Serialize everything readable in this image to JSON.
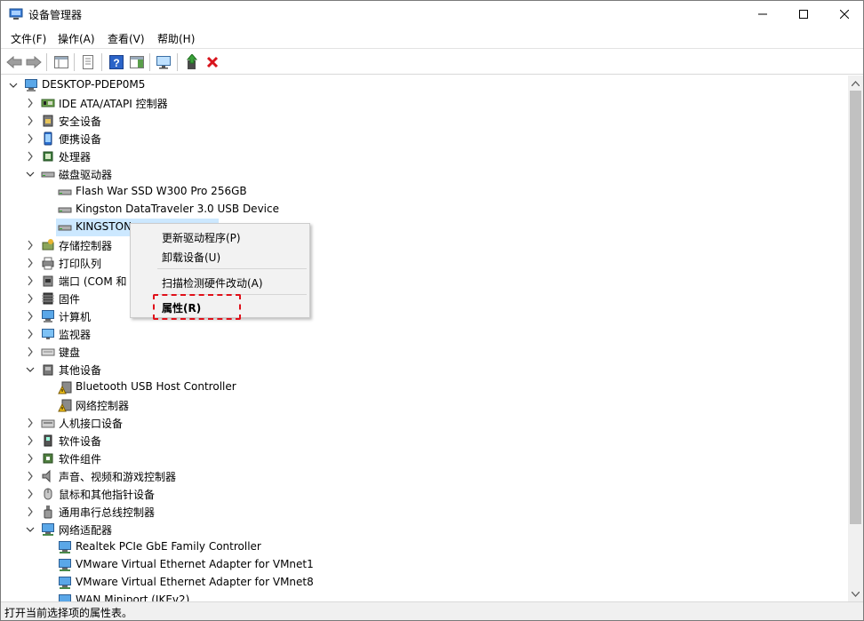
{
  "window": {
    "title": "设备管理器",
    "title_icon": "device-manager-icon"
  },
  "window_controls": {
    "minimize": "─",
    "maximize": "☐",
    "close": "✕"
  },
  "menu": [
    "文件(F)",
    "操作(A)",
    "查看(V)",
    "帮助(H)"
  ],
  "toolbar": [
    "back-arrow-icon",
    "forward-arrow-icon",
    "show-hide-console-tree-icon",
    "properties-sheet-icon",
    "help-icon",
    "action-pane-icon",
    "scan-hardware-icon",
    "update-driver-icon",
    "uninstall-red-x-icon"
  ],
  "tree": {
    "root": "DESKTOP-PDEP0M5",
    "items": [
      {
        "label": "IDE ATA/ATAPI 控制器",
        "level": 1,
        "expanded": false,
        "icon": "ide-controller-icon"
      },
      {
        "label": "安全设备",
        "level": 1,
        "expanded": false,
        "icon": "security-device-icon"
      },
      {
        "label": "便携设备",
        "level": 1,
        "expanded": false,
        "icon": "portable-device-icon"
      },
      {
        "label": "处理器",
        "level": 1,
        "expanded": false,
        "icon": "processor-icon"
      },
      {
        "label": "磁盘驱动器",
        "level": 1,
        "expanded": true,
        "icon": "disk-drive-icon"
      },
      {
        "label": "Flash War SSD W300 Pro 256GB",
        "level": 2,
        "icon": "disk-drive-icon"
      },
      {
        "label": "Kingston DataTraveler 3.0 USB Device",
        "level": 2,
        "icon": "disk-drive-icon"
      },
      {
        "label": "KINGSTON",
        "level": 2,
        "icon": "disk-drive-icon",
        "selected": true
      },
      {
        "label": "存储控制器",
        "level": 1,
        "expanded": false,
        "icon": "storage-controller-icon"
      },
      {
        "label": "打印队列",
        "level": 1,
        "expanded": false,
        "icon": "printer-icon"
      },
      {
        "label": "端口 (COM 和",
        "level": 1,
        "expanded": false,
        "icon": "port-icon"
      },
      {
        "label": "固件",
        "level": 1,
        "expanded": false,
        "icon": "firmware-icon"
      },
      {
        "label": "计算机",
        "level": 1,
        "expanded": false,
        "icon": "computer-icon"
      },
      {
        "label": "监视器",
        "level": 1,
        "expanded": false,
        "icon": "monitor-icon"
      },
      {
        "label": "键盘",
        "level": 1,
        "expanded": false,
        "icon": "keyboard-icon"
      },
      {
        "label": "其他设备",
        "level": 1,
        "expanded": true,
        "icon": "other-devices-icon"
      },
      {
        "label": "Bluetooth USB Host Controller",
        "level": 2,
        "icon": "warning-device-icon"
      },
      {
        "label": "网络控制器",
        "level": 2,
        "icon": "warning-device-icon"
      },
      {
        "label": "人机接口设备",
        "level": 1,
        "expanded": false,
        "icon": "hid-icon"
      },
      {
        "label": "软件设备",
        "level": 1,
        "expanded": false,
        "icon": "software-device-icon"
      },
      {
        "label": "软件组件",
        "level": 1,
        "expanded": false,
        "icon": "software-component-icon"
      },
      {
        "label": "声音、视频和游戏控制器",
        "level": 1,
        "expanded": false,
        "icon": "sound-icon"
      },
      {
        "label": "鼠标和其他指针设备",
        "level": 1,
        "expanded": false,
        "icon": "mouse-icon"
      },
      {
        "label": "通用串行总线控制器",
        "level": 1,
        "expanded": false,
        "icon": "usb-icon"
      },
      {
        "label": "网络适配器",
        "level": 1,
        "expanded": true,
        "icon": "network-adapter-icon"
      },
      {
        "label": "Realtek PCIe GbE Family Controller",
        "level": 2,
        "icon": "network-adapter-icon"
      },
      {
        "label": "VMware Virtual Ethernet Adapter for VMnet1",
        "level": 2,
        "icon": "network-adapter-icon"
      },
      {
        "label": "VMware Virtual Ethernet Adapter for VMnet8",
        "level": 2,
        "icon": "network-adapter-icon"
      },
      {
        "label": "WAN Miniport (IKEv2)",
        "level": 2,
        "icon": "network-adapter-icon"
      }
    ]
  },
  "context_menu": {
    "items": [
      "更新驱动程序(P)",
      "卸载设备(U)",
      "扫描检测硬件改动(A)",
      "属性(R)"
    ]
  },
  "statusbar": {
    "text": "打开当前选择项的属性表。"
  },
  "colors": {
    "selection": "#cce8ff",
    "highlight_dash": "#e0101a",
    "scroll_thumb": "#c1c1c1"
  }
}
